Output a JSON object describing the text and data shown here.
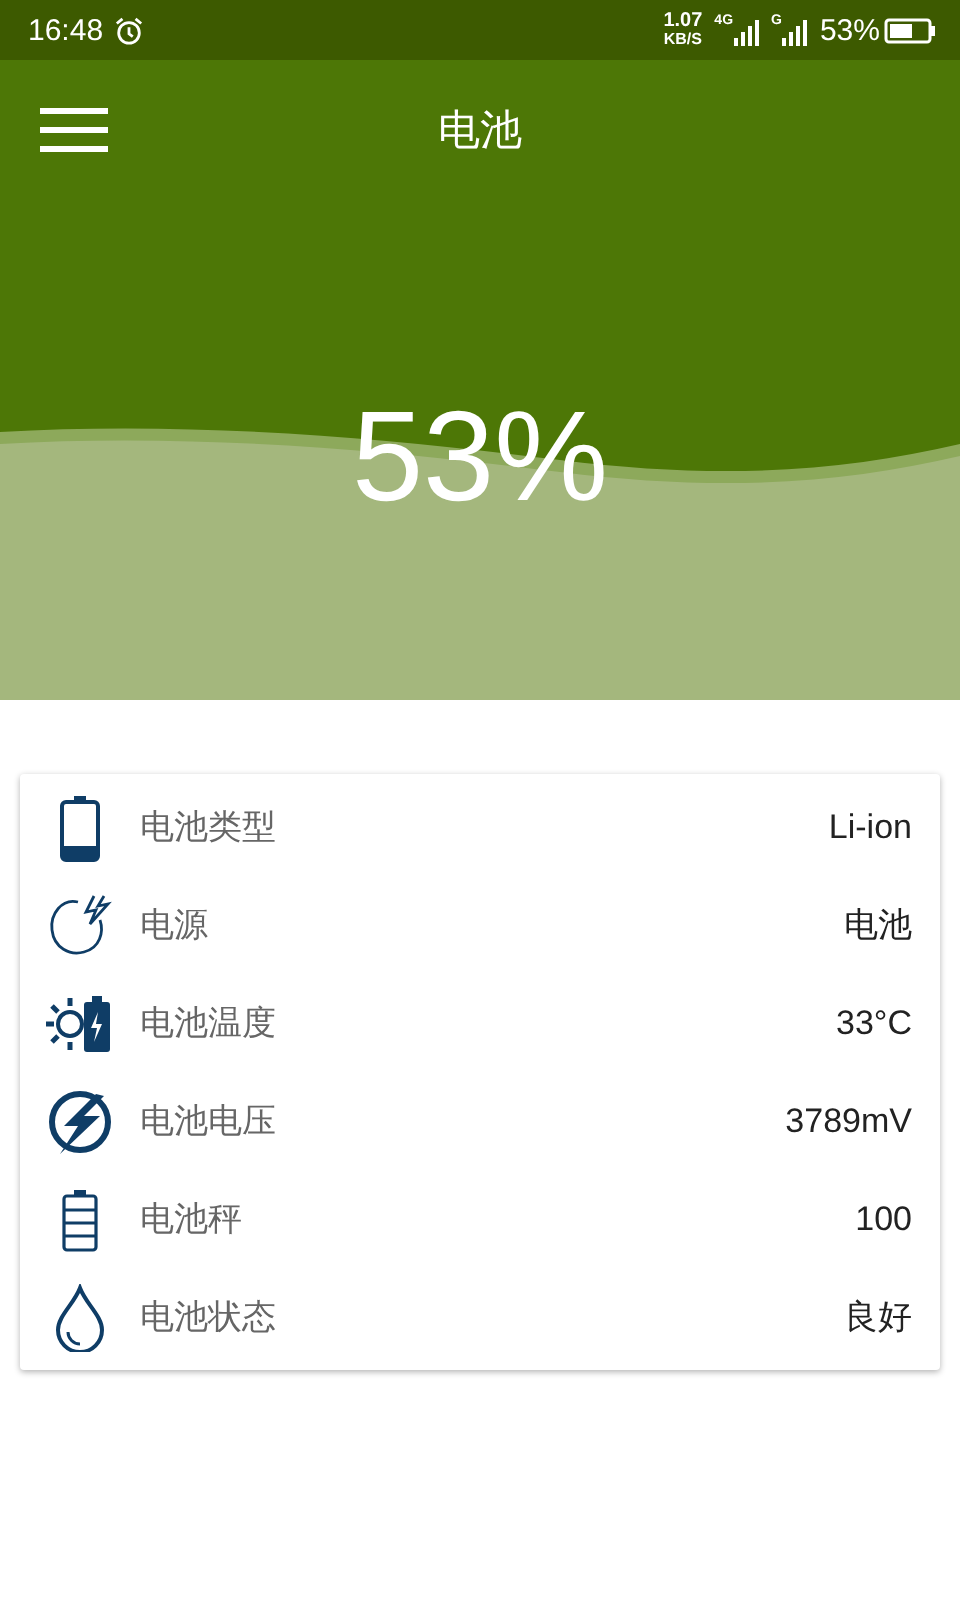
{
  "status_bar": {
    "time": "16:48",
    "speed_value": "1.07",
    "speed_unit": "KB/S",
    "signals": [
      {
        "network": "4G"
      },
      {
        "network": "G"
      }
    ],
    "battery": "53%"
  },
  "app_bar": {
    "title": "电池"
  },
  "hero": {
    "percent": "53%"
  },
  "info_rows": [
    {
      "kind": "type",
      "label": "电池类型",
      "value": "Li-ion"
    },
    {
      "kind": "source",
      "label": "电源",
      "value": "电池"
    },
    {
      "kind": "temperature",
      "label": "电池温度",
      "value": "33°C"
    },
    {
      "kind": "voltage",
      "label": "电池电压",
      "value": "3789mV"
    },
    {
      "kind": "level",
      "label": "电池秤",
      "value": "100"
    },
    {
      "kind": "health",
      "label": "电池状态",
      "value": "良好"
    }
  ]
}
